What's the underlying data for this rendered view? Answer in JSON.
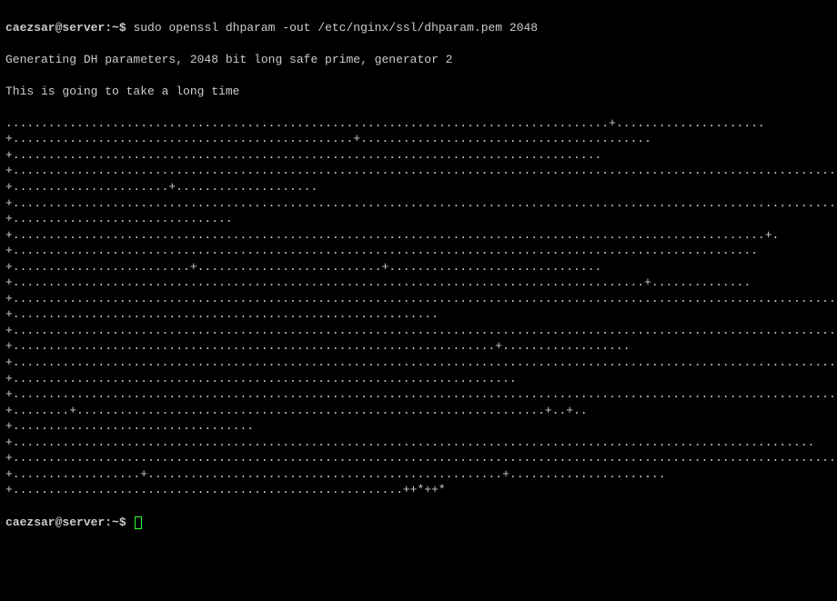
{
  "prompt1": "caezsar@server:~$ ",
  "command": "sudo openssl dhparam -out /etc/nginx/ssl/dhparam.pem 2048",
  "out1": "Generating DH parameters, 2048 bit long safe prime, generator 2",
  "out2": "This is going to take a long time",
  "dots": ".....................................................................................+.....................+................................................+.........................................+...................................................................................+............................................................................................................................................+......................+....................+.......................................................................................................................................................................................................................................+...............................+..........................................................................................................+.+.........................................................................................................+.........................+..........................+..............................+.........................................................................................+..............+......................................................................................................................................................................................................+............................................................+.................................................................................................................................................................................................................................................................................................................................................................................................................................................................................+....................................................................+..................+......................................................................................................................................................................................................................................................................................................................................................................................................................................................................................................................+.......................................................................+.......................................................................................................................................................+........+..................................................................+..+..+..................................+.................................................................................................................+.............................................................................................................................................+..................+..................................................+......................+.......................................................++*++*",
  "prompt2": "caezsar@server:~$ "
}
